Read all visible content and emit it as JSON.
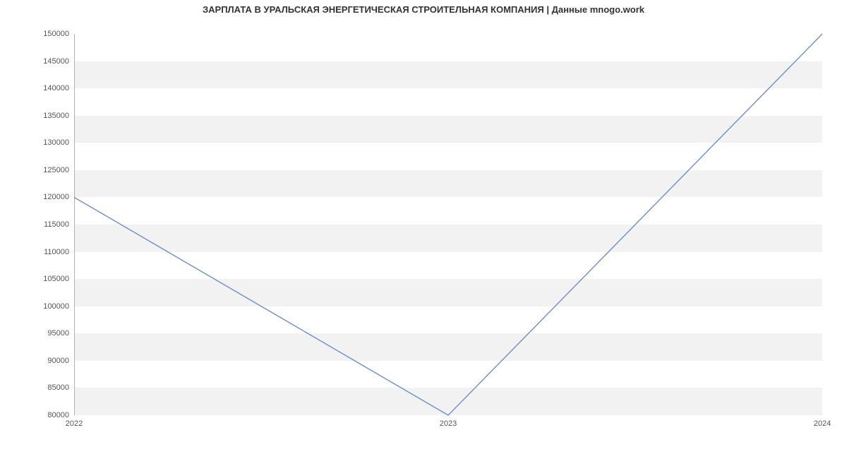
{
  "chart_data": {
    "type": "line",
    "title": "ЗАРПЛАТА В УРАЛЬСКАЯ ЭНЕРГЕТИЧЕСКАЯ СТРОИТЕЛЬНАЯ КОМПАНИЯ  | Данные mnogo.work",
    "x": [
      "2022",
      "2023",
      "2024"
    ],
    "values": [
      120000,
      80000,
      150000
    ],
    "xlabel": "",
    "ylabel": "",
    "ylim": [
      80000,
      150000
    ],
    "y_ticks": [
      80000,
      85000,
      90000,
      95000,
      100000,
      105000,
      110000,
      115000,
      120000,
      125000,
      130000,
      135000,
      140000,
      145000,
      150000
    ],
    "x_ticks": [
      "2022",
      "2023",
      "2024"
    ],
    "line_color": "#6b8ecf"
  }
}
